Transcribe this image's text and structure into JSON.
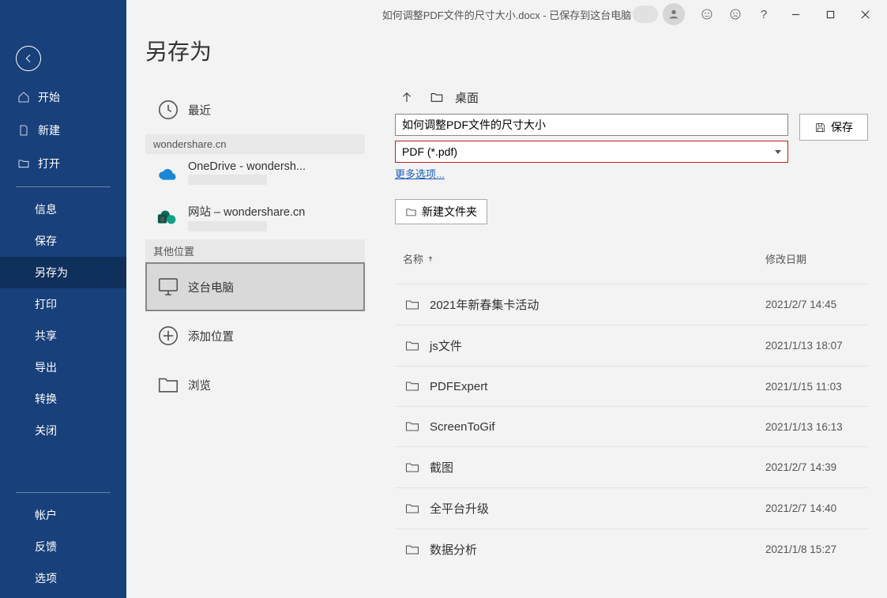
{
  "titlebar": {
    "document_title": "如何调整PDF文件的尺寸大小.docx - 已保存到这台电脑"
  },
  "nav": {
    "home": "开始",
    "new": "新建",
    "open": "打开",
    "info": "信息",
    "save": "保存",
    "save_as": "另存为",
    "print": "打印",
    "share": "共享",
    "export": "导出",
    "transform": "转换",
    "close": "关闭",
    "account": "帐户",
    "feedback": "反馈",
    "options": "选项"
  },
  "page": {
    "title": "另存为"
  },
  "locations": {
    "recent": "最近",
    "account_header": "wondershare.cn",
    "onedrive": "OneDrive - wondersh...",
    "sites": "网站 – wondershare.cn",
    "other_header": "其他位置",
    "this_pc": "这台电脑",
    "add_location": "添加位置",
    "browse": "浏览"
  },
  "browser": {
    "path_label": "桌面",
    "filename": "如何调整PDF文件的尺寸大小",
    "filetype": "PDF (*.pdf)",
    "more_options": "更多选项...",
    "save_btn": "保存",
    "new_folder": "新建文件夹",
    "col_name": "名称",
    "col_date": "修改日期",
    "files": [
      {
        "name": "2021年新春集卡活动",
        "date": "2021/2/7 14:45"
      },
      {
        "name": "js文件",
        "date": "2021/1/13 18:07"
      },
      {
        "name": "PDFExpert",
        "date": "2021/1/15 11:03"
      },
      {
        "name": "ScreenToGif",
        "date": "2021/1/13 16:13"
      },
      {
        "name": "截图",
        "date": "2021/2/7 14:39"
      },
      {
        "name": "全平台升级",
        "date": "2021/2/7 14:40"
      },
      {
        "name": "数据分析",
        "date": "2021/1/8 15:27"
      }
    ]
  }
}
